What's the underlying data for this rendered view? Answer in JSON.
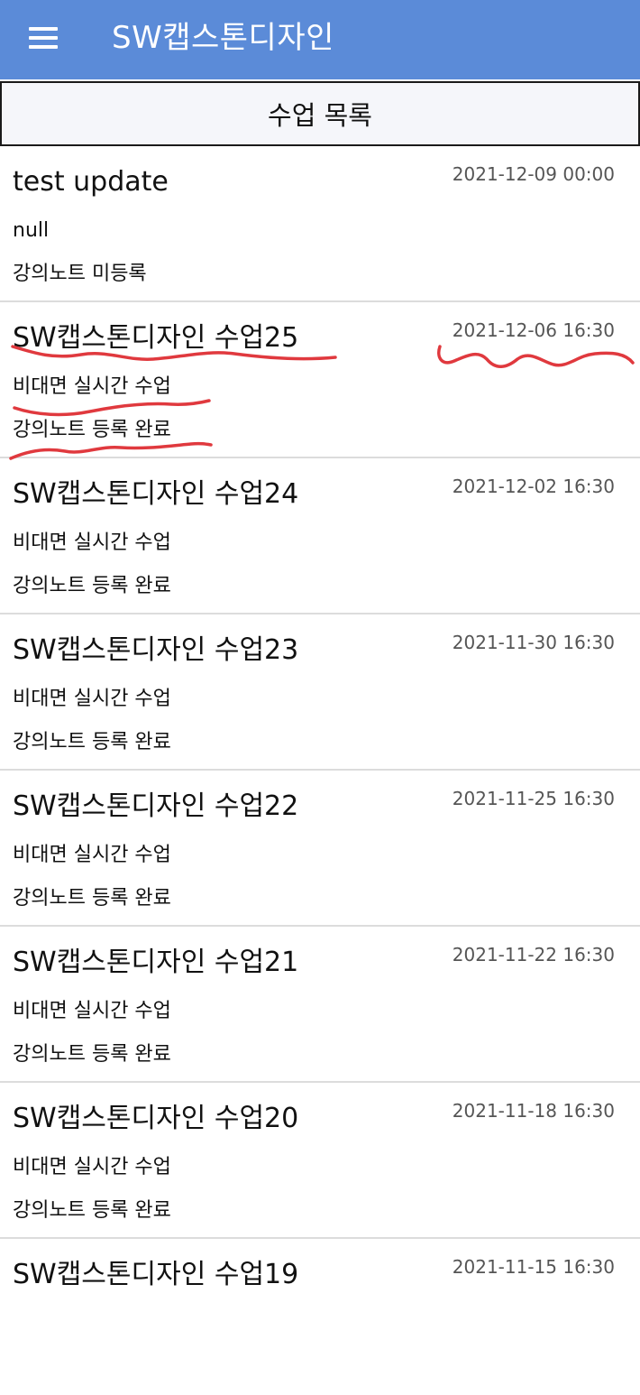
{
  "appbar": {
    "menu_icon": "hamburger-menu-icon",
    "title": "SW캡스톤디자인",
    "color": "#5b8bd8"
  },
  "section": {
    "title": "수업 목록"
  },
  "items": [
    {
      "title": "test update",
      "date": "2021-12-09 00:00",
      "type": "null",
      "status": "강의노트 미등록"
    },
    {
      "title": "SW캡스톤디자인 수업25",
      "date": "2021-12-06 16:30",
      "type": "비대면 실시간 수업",
      "status": "강의노트 등록 완료"
    },
    {
      "title": "SW캡스톤디자인 수업24",
      "date": "2021-12-02 16:30",
      "type": "비대면 실시간 수업",
      "status": "강의노트 등록 완료"
    },
    {
      "title": "SW캡스톤디자인 수업23",
      "date": "2021-11-30 16:30",
      "type": "비대면 실시간 수업",
      "status": "강의노트 등록 완료"
    },
    {
      "title": "SW캡스톤디자인 수업22",
      "date": "2021-11-25 16:30",
      "type": "비대면 실시간 수업",
      "status": "강의노트 등록 완료"
    },
    {
      "title": "SW캡스톤디자인 수업21",
      "date": "2021-11-22 16:30",
      "type": "비대면 실시간 수업",
      "status": "강의노트 등록 완료"
    },
    {
      "title": "SW캡스톤디자인 수업20",
      "date": "2021-11-18 16:30",
      "type": "비대면 실시간 수업",
      "status": "강의노트 등록 완료"
    },
    {
      "title": "SW캡스톤디자인 수업19",
      "date": "2021-11-15 16:30",
      "type": "",
      "status": ""
    }
  ],
  "annotation_color": "#e0393e"
}
